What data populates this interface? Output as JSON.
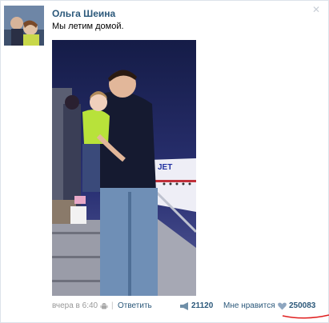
{
  "post": {
    "author": "Ольга Шеина",
    "text": "Мы летим домой.",
    "close_icon": "close-icon",
    "photo_icon": "photo-image"
  },
  "footer": {
    "timestamp": "вчера в 6:40",
    "android_icon": "android-icon",
    "separator": "|",
    "reply_label": "Ответить",
    "repost_icon": "megaphone-icon",
    "repost_count": "21120",
    "like_label": "Мне нравится",
    "heart_icon": "heart-icon",
    "like_count": "250083"
  },
  "colors": {
    "link": "#2b587a",
    "muted": "#999999",
    "annotation_red": "#e02020"
  }
}
